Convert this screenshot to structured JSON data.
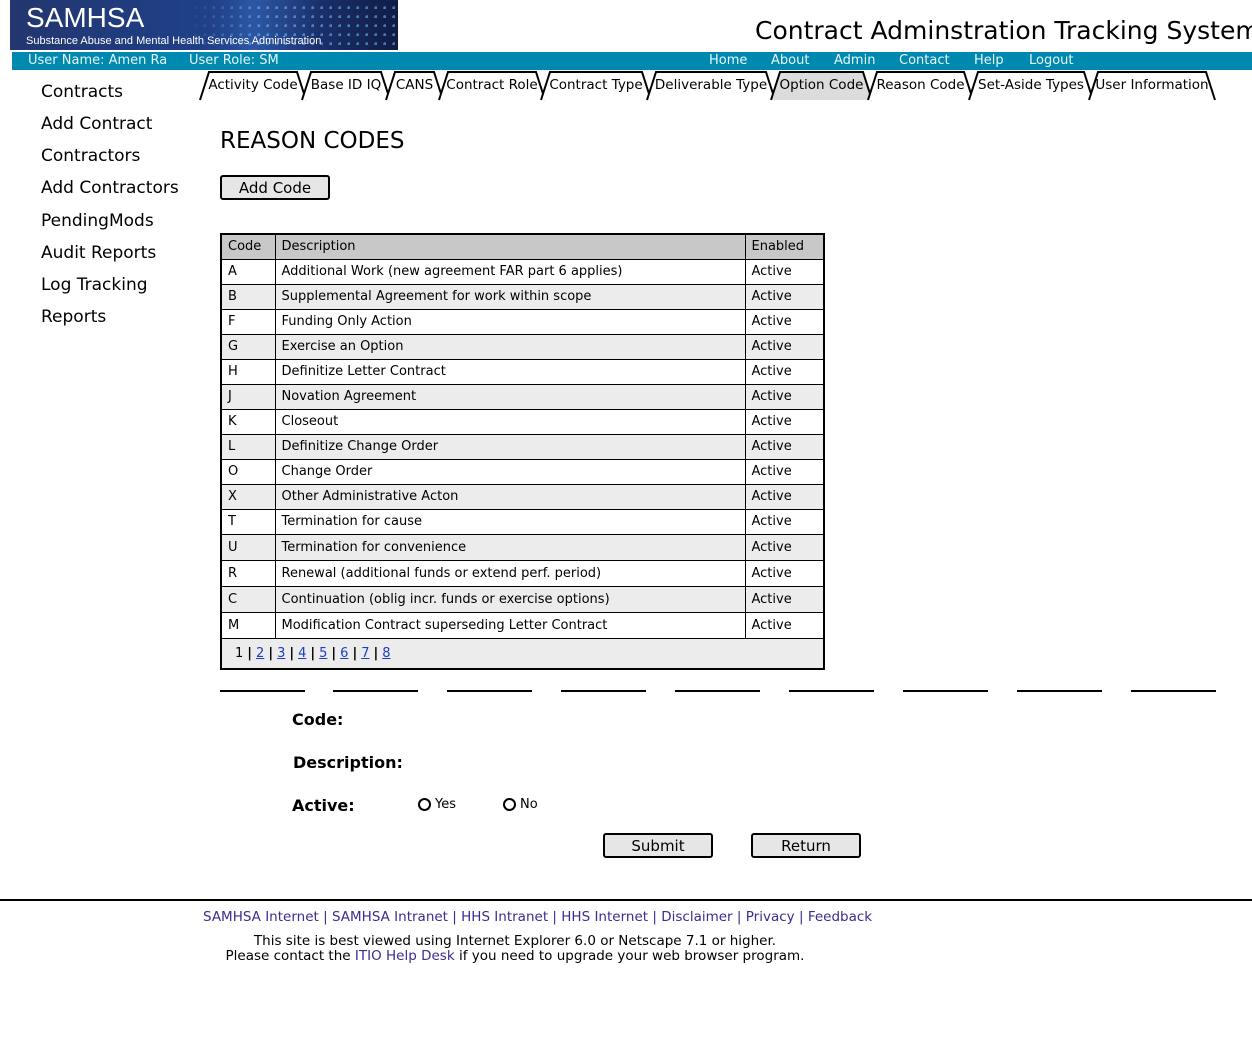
{
  "header": {
    "logo_text": "SAMHSA",
    "logo_subtitle": "Substance Abuse and Mental Health Services Administration",
    "app_title": "Contract Adminstration Tracking System"
  },
  "userbar": {
    "user_name": "User Name: Amen Ra",
    "user_role": "User Role: SM",
    "nav": [
      "Home",
      "About",
      "Admin",
      "Contact",
      "Help",
      "Logout"
    ]
  },
  "tabs": [
    {
      "label": "Activity Code"
    },
    {
      "label": "Base ID IQ"
    },
    {
      "label": "CANS"
    },
    {
      "label": "Contract Role"
    },
    {
      "label": "Contract Type"
    },
    {
      "label": "Deliverable Type"
    },
    {
      "label": "Option Code"
    },
    {
      "label": "Reason Code"
    },
    {
      "label": "Set-Aside Types"
    },
    {
      "label": "User Information"
    }
  ],
  "sidebar": {
    "items": [
      "Contracts",
      "Add Contract",
      "Contractors",
      "Add Contractors",
      "PendingMods",
      "Audit Reports",
      "Log Tracking",
      "Reports"
    ]
  },
  "main": {
    "title": "REASON CODES",
    "add_button": "Add Code",
    "table": {
      "headers": [
        "Code",
        "Description",
        "Enabled"
      ],
      "rows": [
        [
          "A",
          "Additional Work (new agreement FAR part 6 applies)",
          "Active"
        ],
        [
          "B",
          "Supplemental Agreement for work within scope",
          "Active"
        ],
        [
          "F",
          "Funding Only Action",
          "Active"
        ],
        [
          "G",
          "Exercise an Option",
          "Active"
        ],
        [
          "H",
          "Definitize Letter Contract",
          "Active"
        ],
        [
          "J",
          "Novation Agreement",
          "Active"
        ],
        [
          "K",
          "Closeout",
          "Active"
        ],
        [
          "L",
          "Definitize Change Order",
          "Active"
        ],
        [
          "O",
          "Change Order",
          "Active"
        ],
        [
          "X",
          "Other Administrative Acton",
          "Active"
        ],
        [
          "T",
          "Termination for cause",
          "Active"
        ],
        [
          "U",
          "Termination for convenience",
          "Active"
        ],
        [
          "R",
          "Renewal (additional funds or extend perf. period)",
          "Active"
        ],
        [
          "C",
          "Continuation (oblig incr. funds or exercise options)",
          "Active"
        ],
        [
          "M",
          "Modification Contract superseding Letter Contract",
          "Active"
        ]
      ],
      "pager": {
        "current": "1",
        "pages": [
          "2",
          "3",
          "4",
          "5",
          "6",
          "7",
          "8"
        ]
      }
    }
  },
  "form": {
    "code_label": "Code:",
    "description_label": "Description:",
    "active_label": "Active:",
    "yes_label": "Yes",
    "no_label": "No",
    "submit_label": "Submit",
    "return_label": "Return"
  },
  "footer": {
    "links": [
      "SAMHSA Internet",
      "SAMHSA Intranet",
      "HHS Intranet",
      "HHS Internet",
      "Disclaimer",
      "Privacy",
      "Feedback"
    ],
    "note_line1": "This site is best viewed using Internet Explorer 6.0 or Netscape 7.1 or higher.",
    "note_pre": "Please contact the",
    "note_link": "ITIO Help Desk",
    "note_post": "if you need to upgrade your web browser program."
  }
}
